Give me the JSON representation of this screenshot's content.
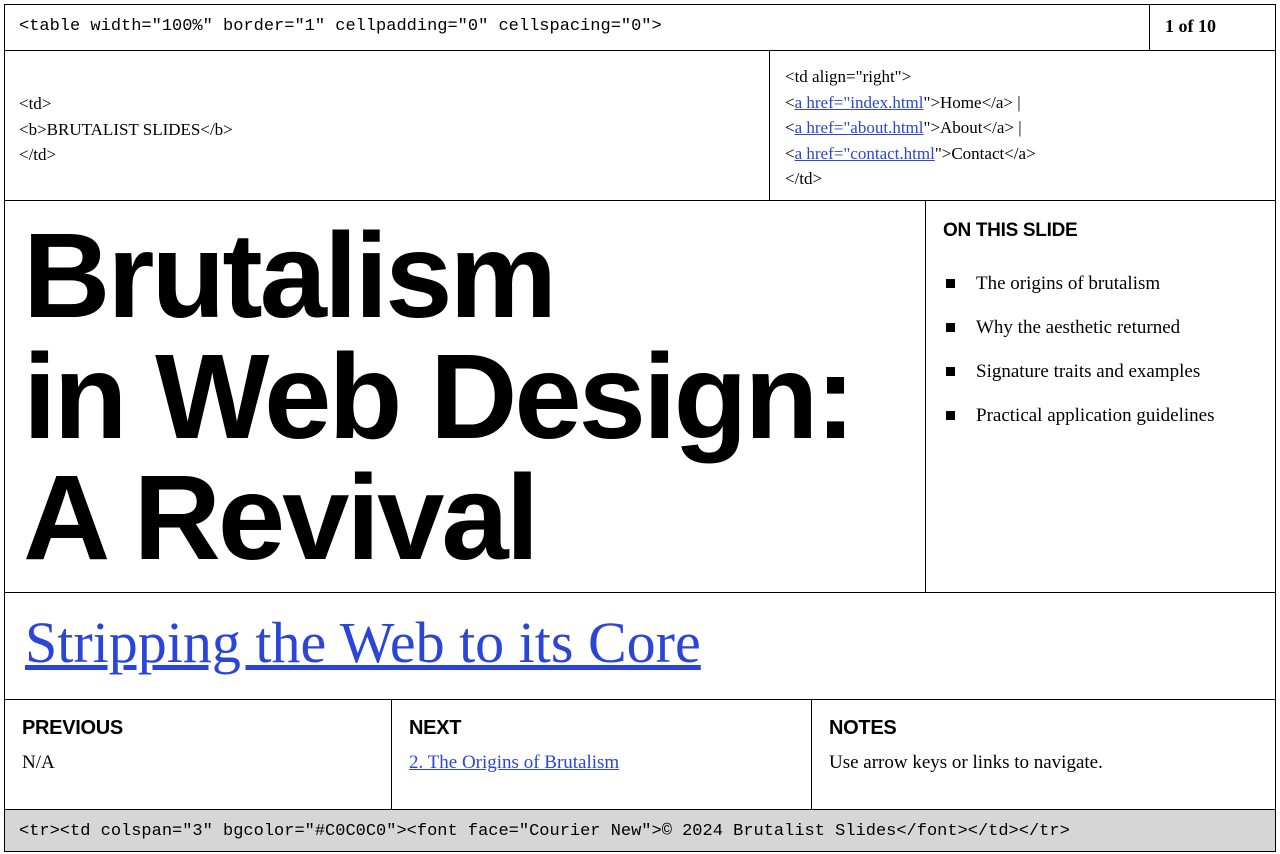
{
  "header": {
    "table_tag": "<table width=\"100%\" border=\"1\" cellpadding=\"0\" cellspacing=\"0\">",
    "page_indicator": "1 of 10"
  },
  "brand": {
    "line1": "<td>",
    "line2": "<b>BRUTALIST SLIDES</b>",
    "line3": "</td>"
  },
  "nav": {
    "open": "<td align=\"right\">",
    "items": [
      {
        "lt": "<",
        "tag": "a href=\"",
        "href": "index.html",
        "rest": "\">Home</a> |"
      },
      {
        "lt": "<",
        "tag": "a href=\"",
        "href": "about.html",
        "rest": "\">About</a> |"
      },
      {
        "lt": "<",
        "tag": "a href=\"",
        "href": "contact.html",
        "rest": "\">Contact</a>"
      }
    ],
    "close": "</td>"
  },
  "slide": {
    "title_lines": [
      "Brutalism",
      "in Web Design:",
      "A Revival"
    ],
    "subtitle": "Stripping the Web to its Core"
  },
  "aside": {
    "heading": "ON THIS SLIDE",
    "items": [
      "The origins of brutalism",
      "Why the aesthetic returned",
      "Signature traits and examples",
      "Practical application guidelines"
    ]
  },
  "footer_nav": {
    "previous": {
      "label": "PREVIOUS",
      "value": "N/A"
    },
    "next": {
      "label": "NEXT",
      "value": "2. The Origins of Brutalism"
    },
    "notes": {
      "label": "NOTES",
      "value": "Use arrow keys or links to navigate."
    }
  },
  "footer": {
    "code": "<tr><td colspan=\"3\" bgcolor=\"#C0C0C0\"><font face=\"Courier New\">© 2024 Brutalist Slides</font></td></tr>"
  },
  "colors": {
    "link": "#2a45d8",
    "footer_bg": "#d6d6d6"
  }
}
